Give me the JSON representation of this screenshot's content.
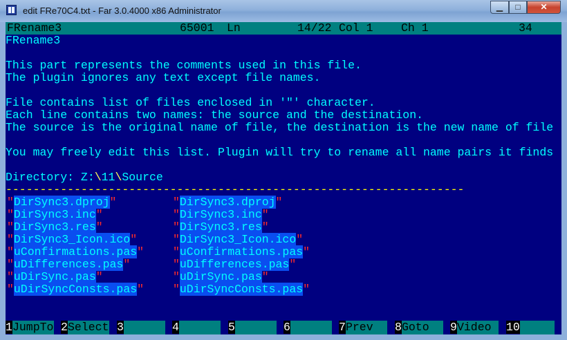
{
  "window": {
    "title": "edit FRe70C4.txt - Far 3.0.4000 x86 Administrator",
    "controls": {
      "minimize": "▁",
      "maximize": "□",
      "close": "✕"
    }
  },
  "status": {
    "filename": "FRename3",
    "codepage": "65001",
    "ln_label": "Ln",
    "line_pos": "14/22",
    "col_label": "Col 1",
    "ch_label": "Ch 1",
    "char_code": "34"
  },
  "text_lines": {
    "l1": "FRename3",
    "l3": "This part represents the comments used in this file.",
    "l4": "The plugin ignores any text except file names.",
    "l6": "File contains list of files enclosed in '\"' character.",
    "l7": "Each line contains two names: the source and the destination.",
    "l8": "The source is the original name of file, the destination is the new name of file",
    "l10": "You may freely edit this list. Plugin will try to rename all name pairs it finds",
    "dir_label": "Directory: ",
    "dir_drive": "Z:",
    "dir_sep1": "\\",
    "dir_num": "11",
    "dir_sep2": "\\",
    "dir_name": "Source",
    "divider": "-------------------------------------------------------------------"
  },
  "file_pairs": [
    {
      "source": "DirSync3.dproj",
      "destination": "DirSync3.dproj"
    },
    {
      "source": "DirSync3.inc",
      "destination": "DirSync3.inc"
    },
    {
      "source": "DirSync3.res",
      "destination": "DirSync3.res"
    },
    {
      "source": "DirSync3_Icon.ico",
      "destination": "DirSync3_Icon.ico"
    },
    {
      "source": "uConfirmations.pas",
      "destination": "uConfirmations.pas"
    },
    {
      "source": "uDifferences.pas",
      "destination": "uDifferences.pas"
    },
    {
      "source": "uDirSync.pas",
      "destination": "uDirSync.pas"
    },
    {
      "source": "uDirSyncConsts.pas",
      "destination": "uDirSyncConsts.pas"
    }
  ],
  "quote_char": "\"",
  "keybar": [
    {
      "num": "1",
      "label": "JumpTo"
    },
    {
      "num": "2",
      "label": "Select"
    },
    {
      "num": "3",
      "label": ""
    },
    {
      "num": "4",
      "label": ""
    },
    {
      "num": "5",
      "label": ""
    },
    {
      "num": "6",
      "label": ""
    },
    {
      "num": "7",
      "label": "Prev"
    },
    {
      "num": "8",
      "label": "Goto"
    },
    {
      "num": "9",
      "label": "Video"
    },
    {
      "num": "10",
      "label": ""
    }
  ],
  "colors": {
    "console_bg": "#000080",
    "text": "#00ffff",
    "status_bg": "#008080",
    "selection": "#0a4ef0",
    "quote": "#ff2b2b"
  }
}
